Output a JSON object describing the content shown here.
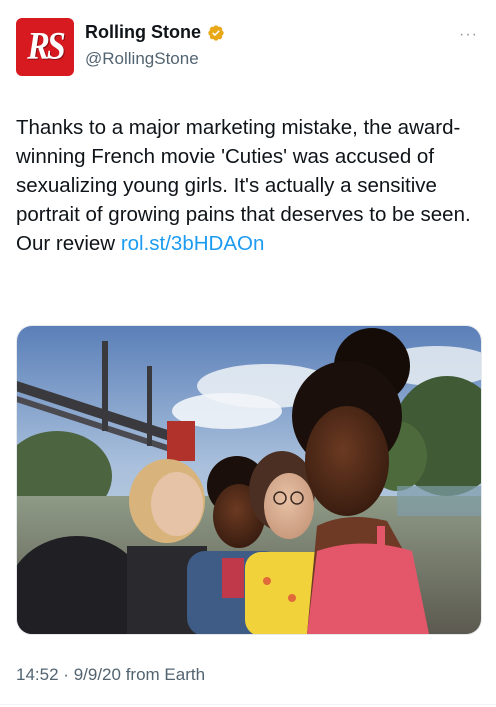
{
  "account": {
    "display_name": "Rolling Stone",
    "handle": "@RollingStone",
    "avatar_text": "RS",
    "verified": true,
    "verified_color": "#e8a817"
  },
  "tweet": {
    "text": "Thanks to a major marketing mistake, the award-winning French movie 'Cuties' was accused of sexualizing young girls. It's actually a sensitive portrait of growing pains that deserves to be seen. Our review ",
    "link_text": "rol.st/3bHDAOn",
    "link_color": "#1d9bf0"
  },
  "meta": {
    "time": "14:52",
    "separator": "·",
    "date": "9/9/20",
    "source": "from Earth"
  },
  "icons": {
    "more": "more-options-icon",
    "verified": "verified-badge-icon"
  },
  "more_label": "···"
}
